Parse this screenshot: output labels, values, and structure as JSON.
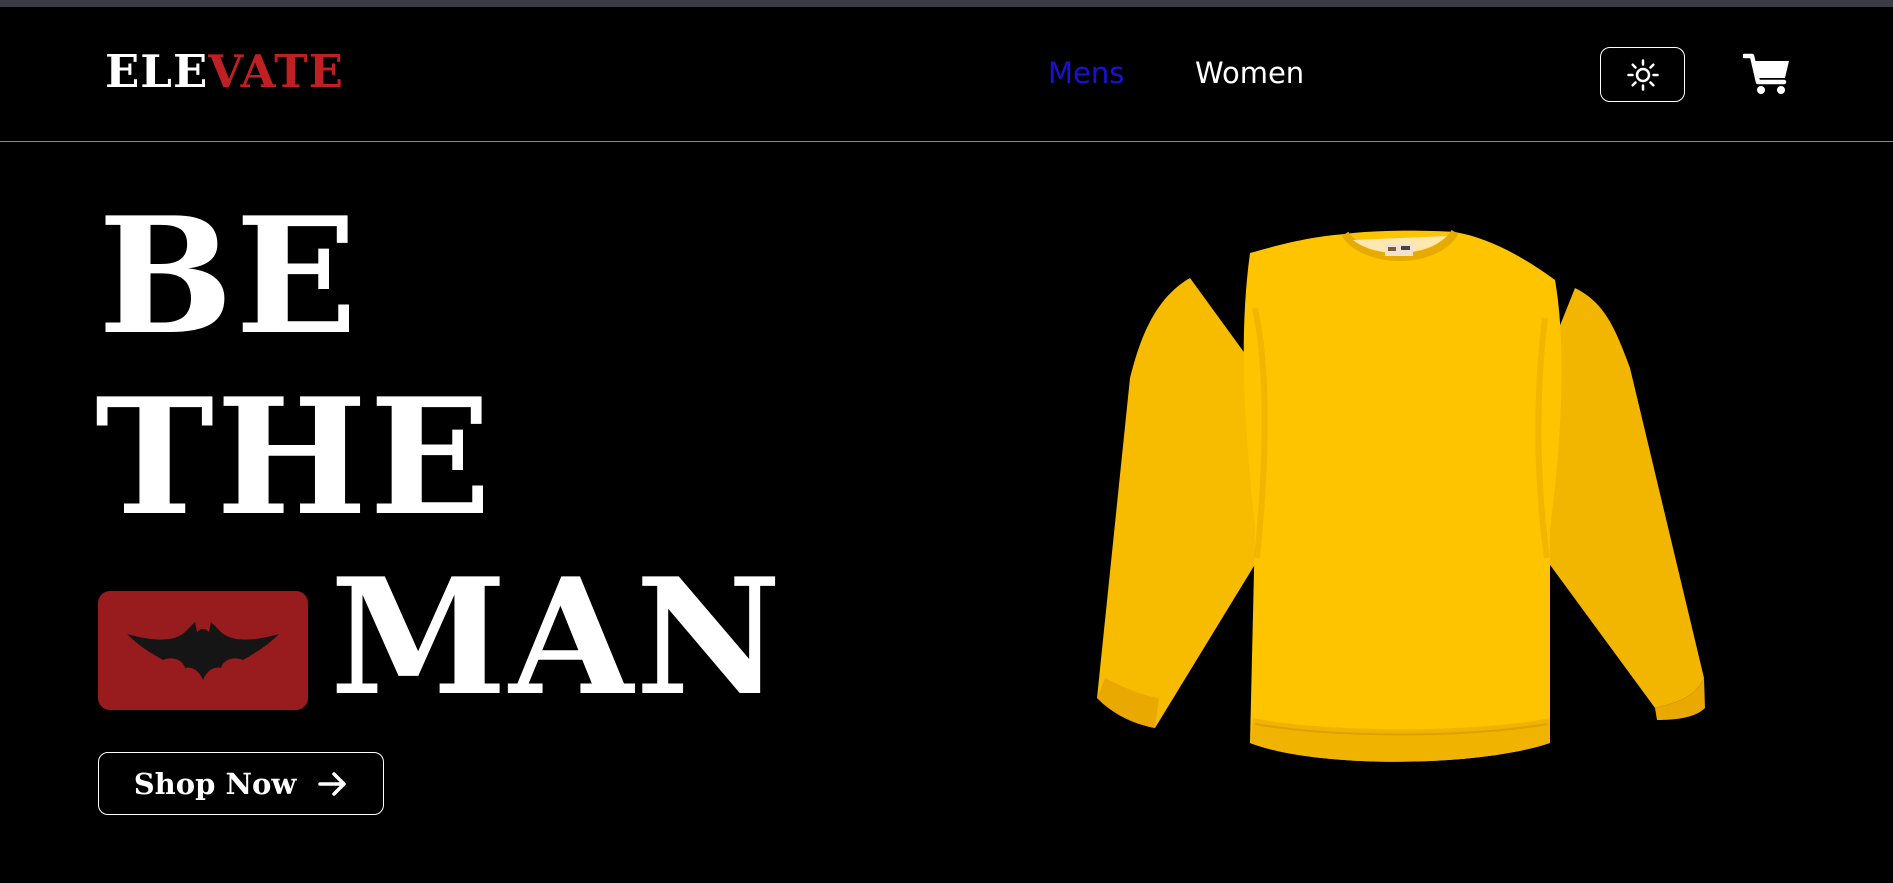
{
  "brand": {
    "part1": "ELE",
    "part2": "VATE"
  },
  "nav": {
    "links": [
      "Mens",
      "Women"
    ]
  },
  "icons": {
    "theme_toggle": "sun-icon",
    "cart": "cart-icon",
    "badge": "bat-logo-icon",
    "shop_arrow": "arrow-right-icon"
  },
  "hero": {
    "line1": "BE",
    "line2": "THE",
    "line3": "MAN",
    "cta_label": "Shop Now"
  },
  "colors": {
    "background": "#000000",
    "brand_accent": "#c01f24",
    "active_nav": "#1a11d6",
    "badge_bg": "#981b1e",
    "product_yellow": "#fbc400"
  }
}
